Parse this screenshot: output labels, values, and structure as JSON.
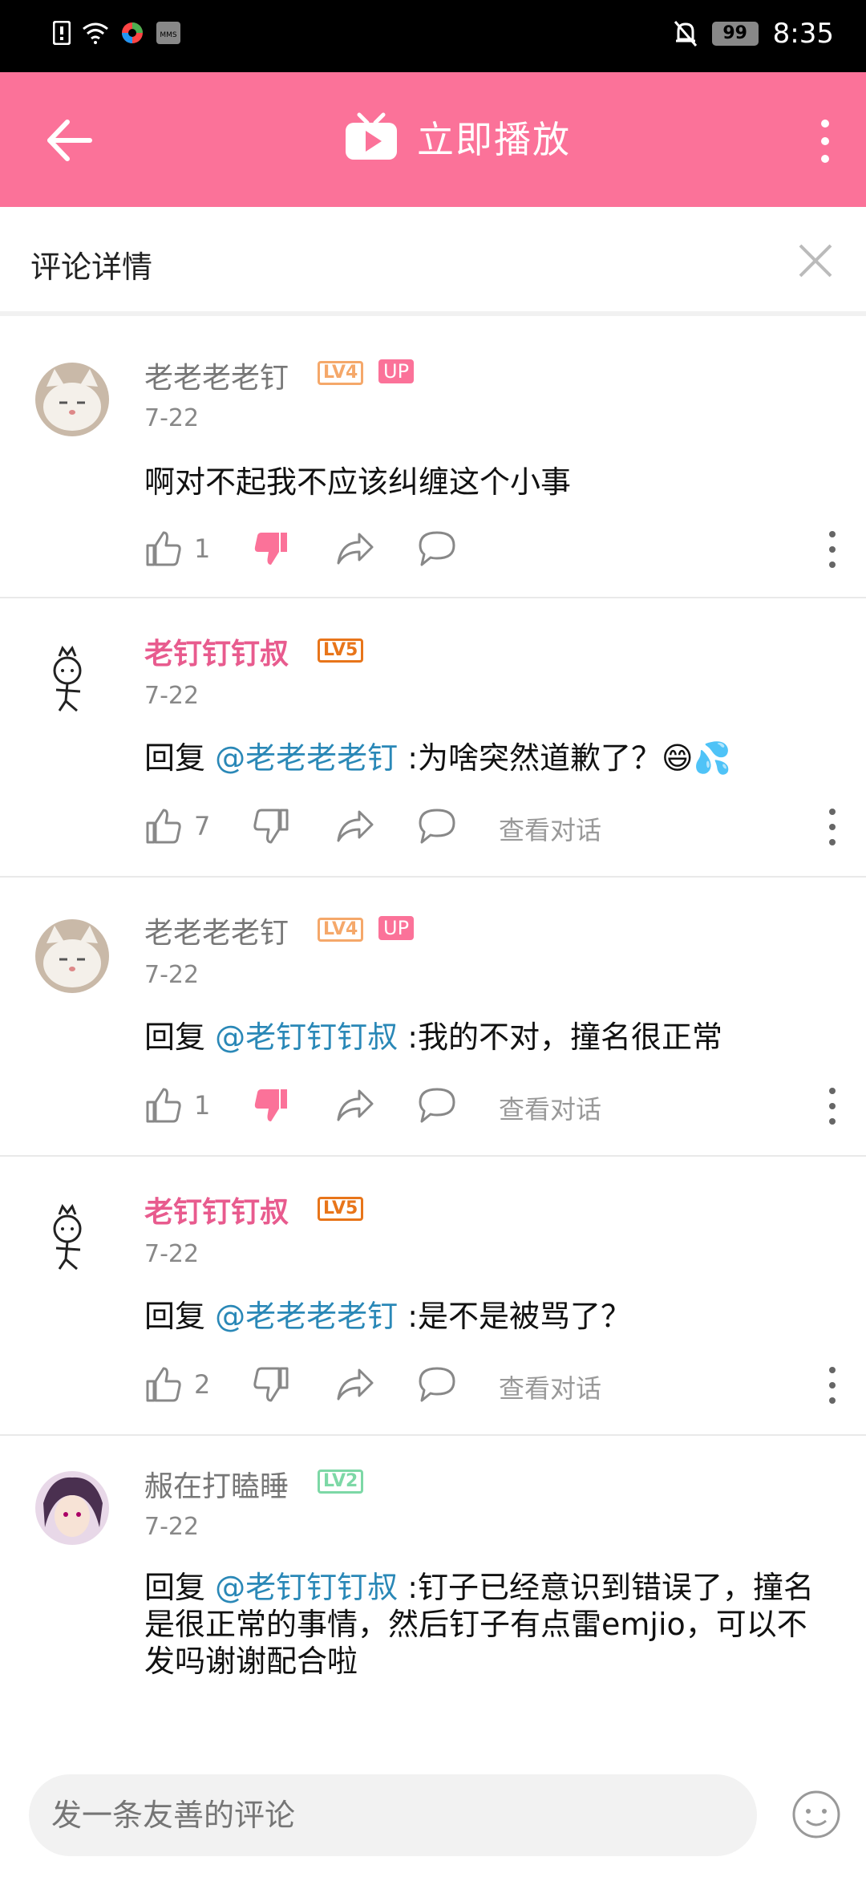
{
  "statusbar": {
    "battery": "99",
    "time": "8:35",
    "left_icons": [
      "sim-warning-icon",
      "wifi-icon",
      "colorful-app-icon",
      "mms-icon"
    ],
    "right_icons": [
      "mute-bell-icon"
    ]
  },
  "header": {
    "play_label": "立即播放"
  },
  "detail": {
    "title": "评论详情"
  },
  "comments": [
    {
      "user": "老老老老钉",
      "level": "LV4",
      "up": "UP",
      "date": "7-22",
      "text": "啊对不起我不应该纠缠这个小事",
      "likes": "1",
      "show_conv": ""
    },
    {
      "user": "老钉钉钉叔",
      "level": "LV5",
      "date": "7-22",
      "reply_prefix": "回复",
      "mention": "@老老老老钉",
      "text": ":为啥突然道歉了？😄💦",
      "likes": "7",
      "show_conv": "查看对话"
    },
    {
      "user": "老老老老钉",
      "level": "LV4",
      "up": "UP",
      "date": "7-22",
      "reply_prefix": "回复",
      "mention": "@老钉钉钉叔",
      "text": ":我的不对，撞名很正常",
      "likes": "1",
      "show_conv": "查看对话"
    },
    {
      "user": "老钉钉钉叔",
      "level": "LV5",
      "date": "7-22",
      "reply_prefix": "回复",
      "mention": "@老老老老钉",
      "text": ":是不是被骂了？",
      "likes": "2",
      "show_conv": "查看对话"
    },
    {
      "user": "赧在打瞌睡",
      "level": "LV2",
      "date": "7-22",
      "reply_prefix": "回复",
      "mention": "@老钉钉钉叔",
      "text": ":钉子已经意识到错误了，撞名是很正常的事情，然后钉子有点雷emjio，可以不发吗谢谢配合啦"
    }
  ],
  "input": {
    "placeholder": "发一条友善的评论"
  },
  "colors": {
    "brand": "#fb7299",
    "mention": "#2a88b7",
    "lv4": "#f5a86a",
    "lv5": "#e8751a",
    "lv2": "#7dd8a6"
  }
}
